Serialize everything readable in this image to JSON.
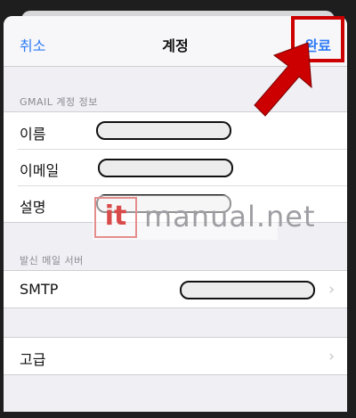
{
  "navbar": {
    "cancel_label": "취소",
    "title": "계정",
    "done_label": "완료"
  },
  "account_section": {
    "header": "GMAIL 계정 정보",
    "rows": [
      {
        "label": "이름"
      },
      {
        "label": "이메일"
      },
      {
        "label": "설명"
      }
    ]
  },
  "outgoing_section": {
    "header": "발신 메일 서버",
    "rows": [
      {
        "label": "SMTP"
      }
    ]
  },
  "advanced_section": {
    "rows": [
      {
        "label": "고급"
      }
    ]
  },
  "watermark": {
    "badge": "it",
    "text": "manual.net"
  },
  "colors": {
    "accent": "#2f7cf6",
    "annotation": "#cc0000"
  }
}
